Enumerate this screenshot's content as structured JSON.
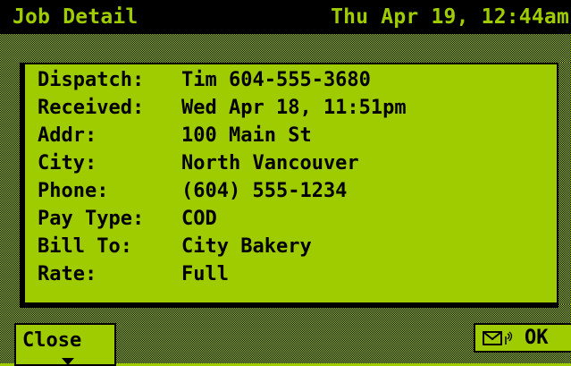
{
  "titlebar": {
    "title": "Job Detail",
    "datetime": "Thu Apr 19, 12:44am"
  },
  "fields": [
    {
      "label": "Dispatch:",
      "value": "Tim 604-555-3680"
    },
    {
      "label": "Received:",
      "value": "Wed Apr 18, 11:51pm"
    },
    {
      "label": "Addr:",
      "value": "100 Main St"
    },
    {
      "label": "City:",
      "value": "North Vancouver"
    },
    {
      "label": "Phone:",
      "value": "(604) 555-1234"
    },
    {
      "label": "Pay Type:",
      "value": "COD"
    },
    {
      "label": "Bill To:",
      "value": "City Bakery"
    },
    {
      "label": "Rate:",
      "value": "Full"
    }
  ],
  "buttons": {
    "close_label": "Close",
    "ok_label": "OK"
  },
  "icons": {
    "close_arrow": "triangle-down-icon",
    "ok_envelope": "envelope-icon",
    "ok_signal": "signal-icon"
  },
  "colors": {
    "screen_green": "#9fcc00",
    "ink": "#000000"
  }
}
